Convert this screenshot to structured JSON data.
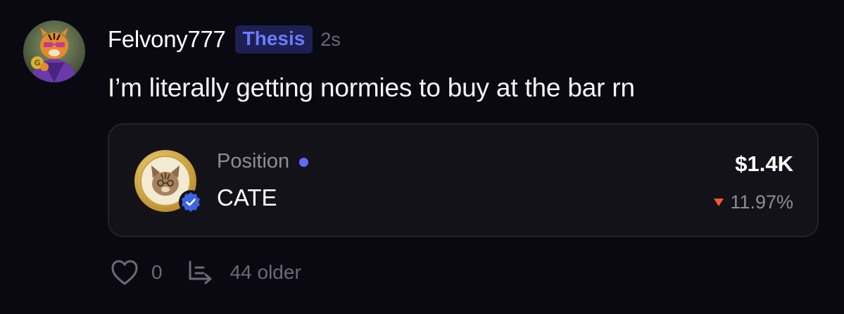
{
  "post": {
    "username": "Felvony777",
    "badge": "Thesis",
    "time_ago": "2s",
    "text": "I’m literally getting normies to buy at the bar rn",
    "avatar_icon": "tiger-avatar-icon"
  },
  "position": {
    "label": "Position",
    "ticker": "CATE",
    "value": "$1.4K",
    "change": "11.97%",
    "change_direction": "down",
    "token_icon": "cate-token-icon",
    "verified_icon": "verified-check-icon"
  },
  "actions": {
    "likes": "0",
    "older_label": "44 older",
    "like_icon": "heart-icon",
    "thread_icon": "thread-icon"
  },
  "colors": {
    "background": "#0a0810",
    "accent": "#5b6cf9",
    "badge_bg": "#1c2052",
    "badge_text": "#6b7cff",
    "negative": "#f25a2c",
    "muted": "#6d6a78"
  }
}
